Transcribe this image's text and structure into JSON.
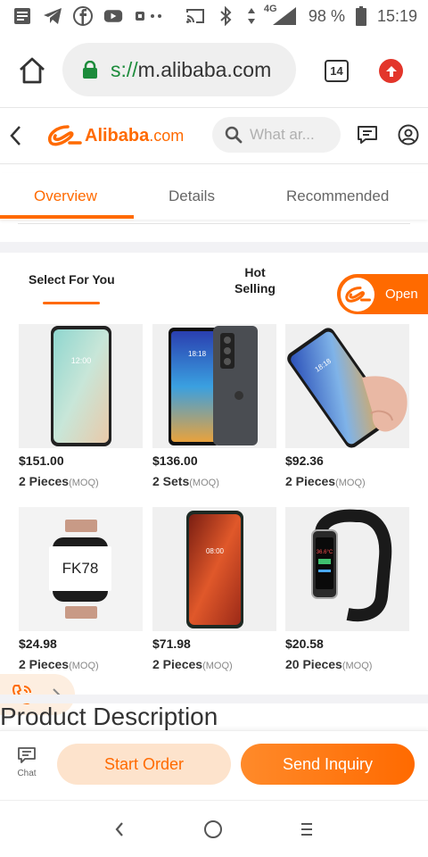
{
  "status_bar": {
    "network": "4G",
    "battery": "98 %",
    "time": "15:19",
    "icons": [
      "notes-icon",
      "telegram-icon",
      "facebook-icon",
      "youtube-icon",
      "more-dots-icon",
      "cast-icon",
      "bluetooth-icon",
      "data-arrows-icon",
      "signal-icon",
      "battery-icon"
    ]
  },
  "browser": {
    "url_scheme": "s://",
    "url_host": "m.alibaba.com",
    "tab_count": "14",
    "icons": [
      "home-icon",
      "lock-icon",
      "upload-icon"
    ]
  },
  "header": {
    "logo_name": "Alibaba",
    "logo_domain": ".com",
    "search_placeholder": "What ar...",
    "icons": [
      "back-icon",
      "search-icon",
      "message-icon",
      "user-icon"
    ]
  },
  "page_tabs": [
    {
      "label": "Overview",
      "active": true
    },
    {
      "label": "Details",
      "active": false
    },
    {
      "label": "Recommended",
      "active": false
    }
  ],
  "subtabs": {
    "select_for_you": "Select For You",
    "hot_selling_line1": "Hot",
    "hot_selling_line2": "Selling",
    "open_button": "Open"
  },
  "products": [
    {
      "price": "$151.00",
      "quantity": "2 Pieces",
      "unit_note": "(MOQ)",
      "image": "phone-teal-front"
    },
    {
      "price": "$136.00",
      "quantity": "2 Sets",
      "unit_note": "(MOQ)",
      "image": "phone-blue-and-black-back"
    },
    {
      "price": "$92.36",
      "quantity": "2 Pieces",
      "unit_note": "(MOQ)",
      "image": "phone-in-hand"
    },
    {
      "price": "$24.98",
      "quantity": "2 Pieces",
      "unit_note": "(MOQ)",
      "image": "smart-watch-band",
      "image_text": "FK78"
    },
    {
      "price": "$71.98",
      "quantity": "2 Pieces",
      "unit_note": "(MOQ)",
      "image": "phone-red-screen"
    },
    {
      "price": "$20.58",
      "quantity": "20 Pieces",
      "unit_note": "(MOQ)",
      "image": "fitness-band"
    }
  ],
  "section_title": "Product Description",
  "action_bar": {
    "chat_label": "Chat",
    "start_order": "Start Order",
    "send_inquiry": "Send Inquiry"
  },
  "colors": {
    "brand_orange": "#ff6a00",
    "start_order_bg": "#fde3cc",
    "url_green": "#1c8b3b",
    "upload_red": "#e3362b"
  }
}
